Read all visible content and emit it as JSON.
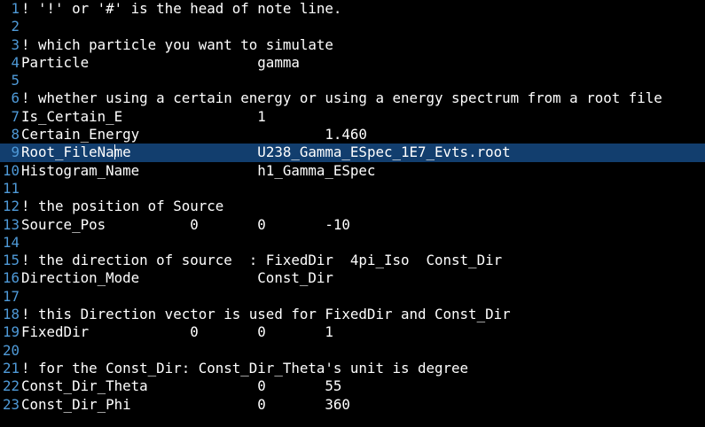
{
  "editor": {
    "theme": {
      "background": "#000000",
      "text_color": "#ffffff",
      "line_number_color": "#4f9ad8",
      "current_line_highlight": "#123e6e"
    },
    "cursor": {
      "line": 9,
      "column": 11
    },
    "lines": [
      {
        "number": "1",
        "text": "! '!' or '#' is the head of note line."
      },
      {
        "number": "2",
        "text": ""
      },
      {
        "number": "3",
        "text": "! which particle you want to simulate"
      },
      {
        "number": "4",
        "text": "Particle                    gamma"
      },
      {
        "number": "5",
        "text": ""
      },
      {
        "number": "6",
        "text": "! whether using a certain energy or using a energy spectrum from a root file"
      },
      {
        "number": "7",
        "text": "Is_Certain_E                1"
      },
      {
        "number": "8",
        "text": "Certain_Energy                      1.460"
      },
      {
        "number": "9",
        "text": "Root_FileName               U238_Gamma_ESpec_1E7_Evts.root",
        "current": true
      },
      {
        "number": "10",
        "text": "Histogram_Name              h1_Gamma_ESpec"
      },
      {
        "number": "11",
        "text": ""
      },
      {
        "number": "12",
        "text": "! the position of Source"
      },
      {
        "number": "13",
        "text": "Source_Pos          0       0       -10"
      },
      {
        "number": "14",
        "text": ""
      },
      {
        "number": "15",
        "text": "! the direction of source  : FixedDir  4pi_Iso  Const_Dir"
      },
      {
        "number": "16",
        "text": "Direction_Mode              Const_Dir"
      },
      {
        "number": "17",
        "text": ""
      },
      {
        "number": "18",
        "text": "! this Direction vector is used for FixedDir and Const_Dir"
      },
      {
        "number": "19",
        "text": "FixedDir            0       0       1"
      },
      {
        "number": "20",
        "text": ""
      },
      {
        "number": "21",
        "text": "! for the Const_Dir: Const_Dir_Theta's unit is degree"
      },
      {
        "number": "22",
        "text": "Const_Dir_Theta             0       55"
      },
      {
        "number": "23",
        "text": "Const_Dir_Phi               0       360"
      }
    ]
  }
}
